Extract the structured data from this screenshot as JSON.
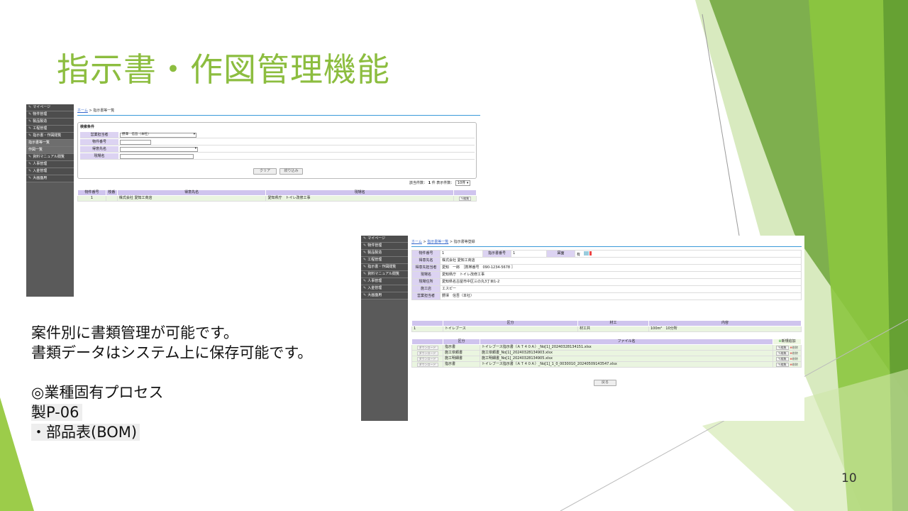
{
  "slide": {
    "title": "指示書・作図管理機能",
    "body_lines": [
      "案件別に書類管理が可能です。",
      "書類データはシステム上に保存可能です。",
      "",
      "◎業種固有プロセス",
      "製P-06",
      "・部品表(BOM)"
    ],
    "page_number": "10",
    "accent_color": "#8cbd3f"
  },
  "shot1": {
    "sidebar": [
      {
        "label": "マイページ",
        "icon": "pencil-icon",
        "sub": false
      },
      {
        "label": "物件管理",
        "icon": "pencil-icon",
        "sub": false
      },
      {
        "label": "製品製造",
        "icon": "pencil-icon",
        "sub": false
      },
      {
        "label": "工程管理",
        "icon": "pencil-icon",
        "sub": false
      },
      {
        "label": "指示書・作図閲覧",
        "icon": "pencil-icon",
        "sub": false
      },
      {
        "label": "指示書等一覧",
        "icon": "",
        "sub": true
      },
      {
        "label": "作図一覧",
        "icon": "",
        "sub": true
      },
      {
        "label": "資料マニュアル閲覧",
        "icon": "pencil-icon",
        "sub": false
      },
      {
        "label": "人事管理",
        "icon": "pencil-icon",
        "sub": false
      },
      {
        "label": "入金管理",
        "icon": "pencil-icon",
        "sub": false
      },
      {
        "label": "大画面用",
        "icon": "pencil-icon",
        "sub": false
      }
    ],
    "breadcrumb_home": "ホーム",
    "breadcrumb_sep": ">",
    "breadcrumb_current": "指示書等一覧",
    "search_title": "検索条件",
    "fields": [
      {
        "label": "営業担当者",
        "value": "野澤　信吾（本社）",
        "type": "select"
      },
      {
        "label": "物件番号",
        "value": "",
        "type": "text-short"
      },
      {
        "label": "得意先名",
        "value": "",
        "type": "select"
      },
      {
        "label": "現場名",
        "value": "",
        "type": "text"
      }
    ],
    "clear_label": "クリア",
    "filter_label": "絞り込み",
    "pager_count_label": "該当件数：",
    "pager_count": "1",
    "pager_count_unit": "件",
    "pager_display_label": "表示件数：",
    "pager_display_value": "10件",
    "table_headers": [
      "物件番号",
      "枝番",
      "得意先名",
      "現場名",
      ""
    ],
    "rows": [
      {
        "no": "1",
        "branch": "",
        "customer": "株式会社 愛知工商店",
        "site": "愛知県庁　トイレ改修工事",
        "action": "編集"
      }
    ]
  },
  "shot2": {
    "sidebar": [
      {
        "label": "マイページ",
        "icon": "pencil-icon",
        "sub": false
      },
      {
        "label": "物件管理",
        "icon": "pencil-icon",
        "sub": false
      },
      {
        "label": "製品製造",
        "icon": "pencil-icon",
        "sub": false
      },
      {
        "label": "工程管理",
        "icon": "pencil-icon",
        "sub": false
      },
      {
        "label": "指示書・作図閲覧",
        "icon": "pencil-icon",
        "sub": false
      },
      {
        "label": "資料マニュアル閲覧",
        "icon": "pencil-icon",
        "sub": false
      },
      {
        "label": "人事管理",
        "icon": "pencil-icon",
        "sub": false
      },
      {
        "label": "入金管理",
        "icon": "pencil-icon",
        "sub": false
      },
      {
        "label": "大画面用",
        "icon": "pencil-icon",
        "sub": false
      }
    ],
    "breadcrumb_home": "ホーム",
    "breadcrumb_list": "指示書等一覧",
    "breadcrumb_sep": ">",
    "breadcrumb_current": "指示書等登録",
    "detail": {
      "l_no": "物件番号",
      "v_no": "1",
      "l_inst": "指示書番号",
      "v_inst": "1",
      "l_drawing": "図面",
      "v_drawing": "有",
      "l_customer": "得意先名",
      "v_customer": "株式会社 愛知工商店",
      "l_contact": "得意先担当者",
      "v_contact": "愛知　一郎　［携帯番号　090-1234-5678 ］",
      "l_site": "現場名",
      "v_site": "愛知県庁　トイレ改修工事",
      "l_addr": "現場住所",
      "v_addr": "愛知県名古屋市中区三の丸3丁目1-2",
      "l_builder": "施工店",
      "v_builder": "エスピー",
      "l_sales": "営業担当者",
      "v_sales": "野澤　信吾（本社）"
    },
    "items_headers": [
      "",
      "区分",
      "材工",
      "内容"
    ],
    "items": [
      {
        "no": "1",
        "category": "トイレブース",
        "type": "材工共",
        "content": "100m²　10分所"
      }
    ],
    "files_headers": [
      "",
      "区分",
      "ファイル名",
      "新規追加"
    ],
    "files": [
      {
        "dl": "ダウンロード",
        "category": "指示書",
        "name": "トイレブース指示書（ＡＴ４０Ａ）_No[1]_20240328134151.xlsx",
        "edit": "編集",
        "del": "削除"
      },
      {
        "dl": "ダウンロード",
        "category": "施工依頼書",
        "name": "施工依頼書_No[1]_20240328134903.xlsx",
        "edit": "編集",
        "del": "削除"
      },
      {
        "dl": "ダウンロード",
        "category": "施工明細書",
        "name": "施工明細書_No[1]_20240328134905.xlsx",
        "edit": "編集",
        "del": "削除"
      },
      {
        "dl": "ダウンロード",
        "category": "指示書",
        "name": "トイレブース指示書（ＡＴ４０Ａ）_No[1]_1_0_0030010_20240509143547.xlsx",
        "edit": "編集",
        "del": "削除"
      }
    ],
    "back_label": "戻る"
  }
}
